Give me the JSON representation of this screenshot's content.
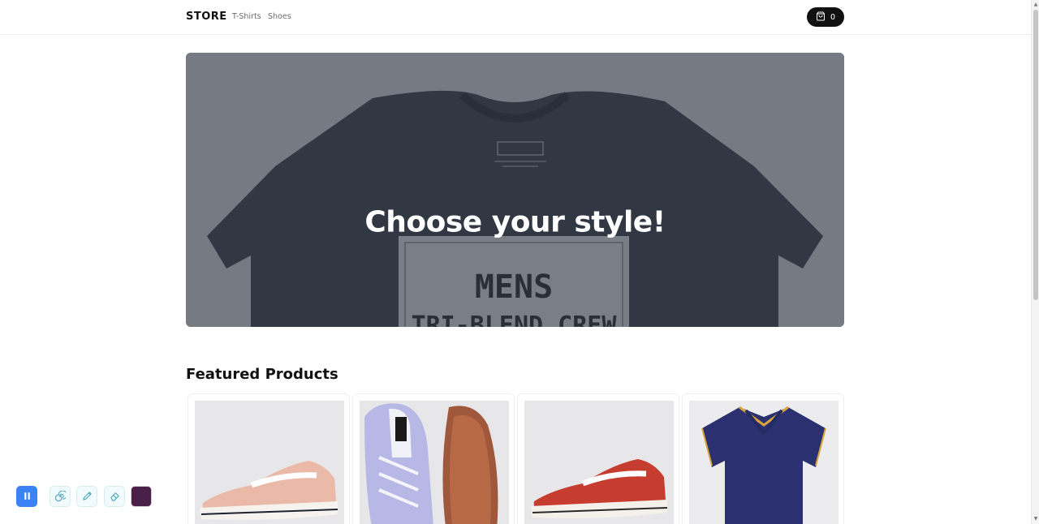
{
  "nav": {
    "brand": "STORE",
    "links": [
      {
        "label": "T-Shirts"
      },
      {
        "label": "Shoes"
      }
    ],
    "cart_count": "0"
  },
  "hero": {
    "title": "Choose your style!",
    "print_mens": "MENS",
    "print_line2": "TRI-BLEND CREW"
  },
  "featured": {
    "title": "Featured Products",
    "products": [
      {
        "image": "pink-sneaker"
      },
      {
        "image": "lavender-sneaker"
      },
      {
        "image": "red-sneaker"
      },
      {
        "image": "navy-polo"
      }
    ]
  },
  "toolbar": {
    "tools": [
      "pause-icon",
      "spiral-icon",
      "pencil-icon",
      "eraser-icon"
    ],
    "active_color": "#4a1f4a",
    "accent": "#3b82f6"
  }
}
